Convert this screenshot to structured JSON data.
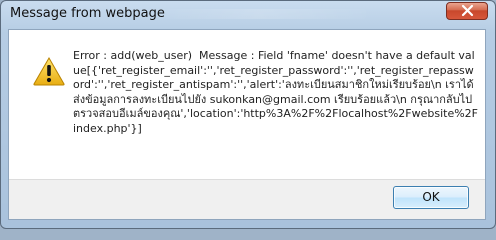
{
  "dialog": {
    "title": "Message from webpage",
    "close_icon": "close-icon",
    "warning_icon": "warning-icon",
    "message": "Error : add(web_user)  Message : Field 'fname' doesn't have a default value[{'ret_register_email':'','ret_register_password':'','ret_register_repassword':'','ret_register_antispam':'','alert':'ลงทะเบียนสมาชิกใหม่เรียบร้อย\\n เราได้ส่งข้อมูลการลงทะเบียนไปยัง sukonkan@gmail.com เรียบร้อยแล้ว\\n กรุณากลับไปตรวจสอบอีเมล์ของคุณ','location':'http%3A%2F%2Flocalhost%2Fwebsite%2Findex.php'}]",
    "ok_label": "OK",
    "accent_colors": {
      "title_bar": "#b6cde4",
      "close_button": "#c7472b",
      "ok_border": "#3c7fb1",
      "warning_yellow": "#f2c230"
    }
  }
}
